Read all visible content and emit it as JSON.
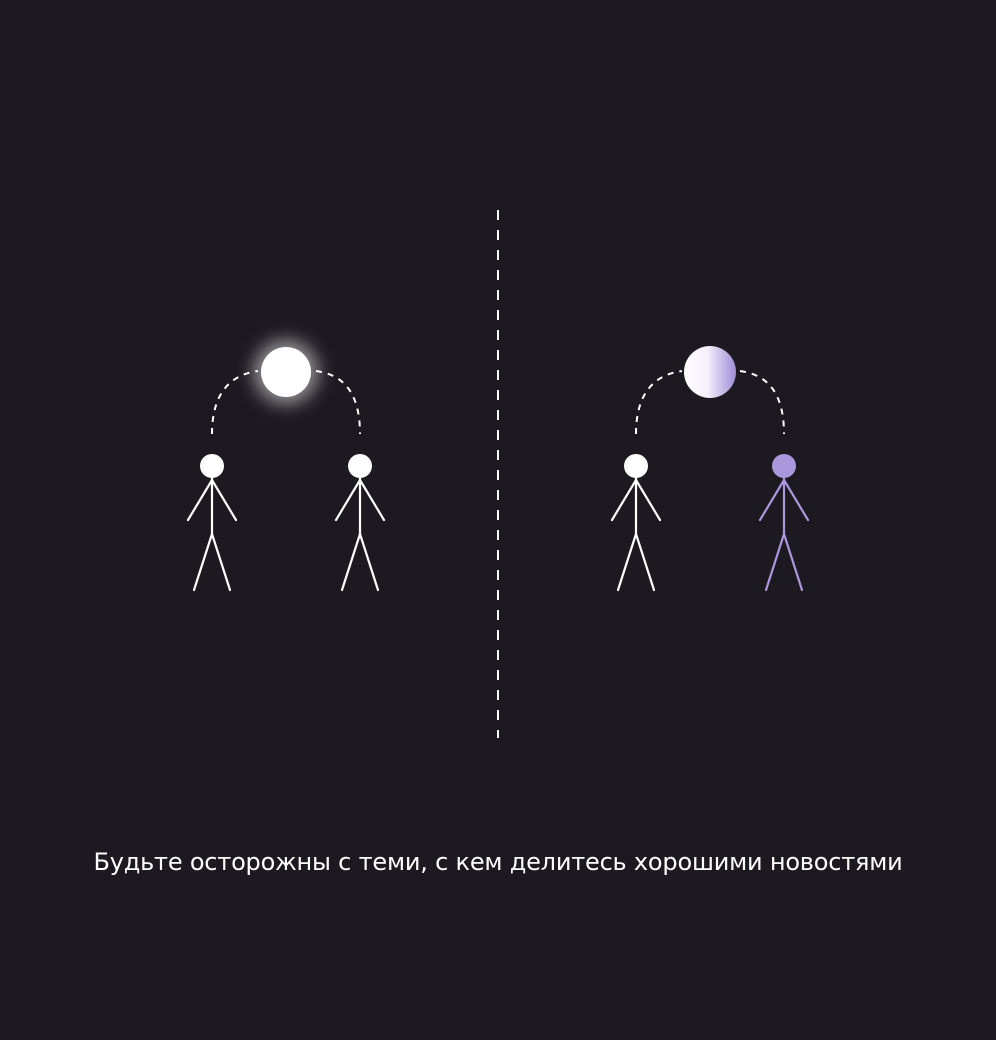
{
  "caption": "Будьте осторожны с теми, с кем делитесь хорошими новостями",
  "colors": {
    "background": "#1d1921",
    "figure": "#ffffff",
    "accent": "#a998dc"
  },
  "icons": {
    "left_pair": [
      "stick-figure-icon",
      "stick-figure-icon"
    ],
    "right_pair": [
      "stick-figure-icon",
      "stick-figure-purple-icon"
    ],
    "left_orb": "glowing-orb-icon",
    "right_orb": "gradient-orb-icon"
  }
}
